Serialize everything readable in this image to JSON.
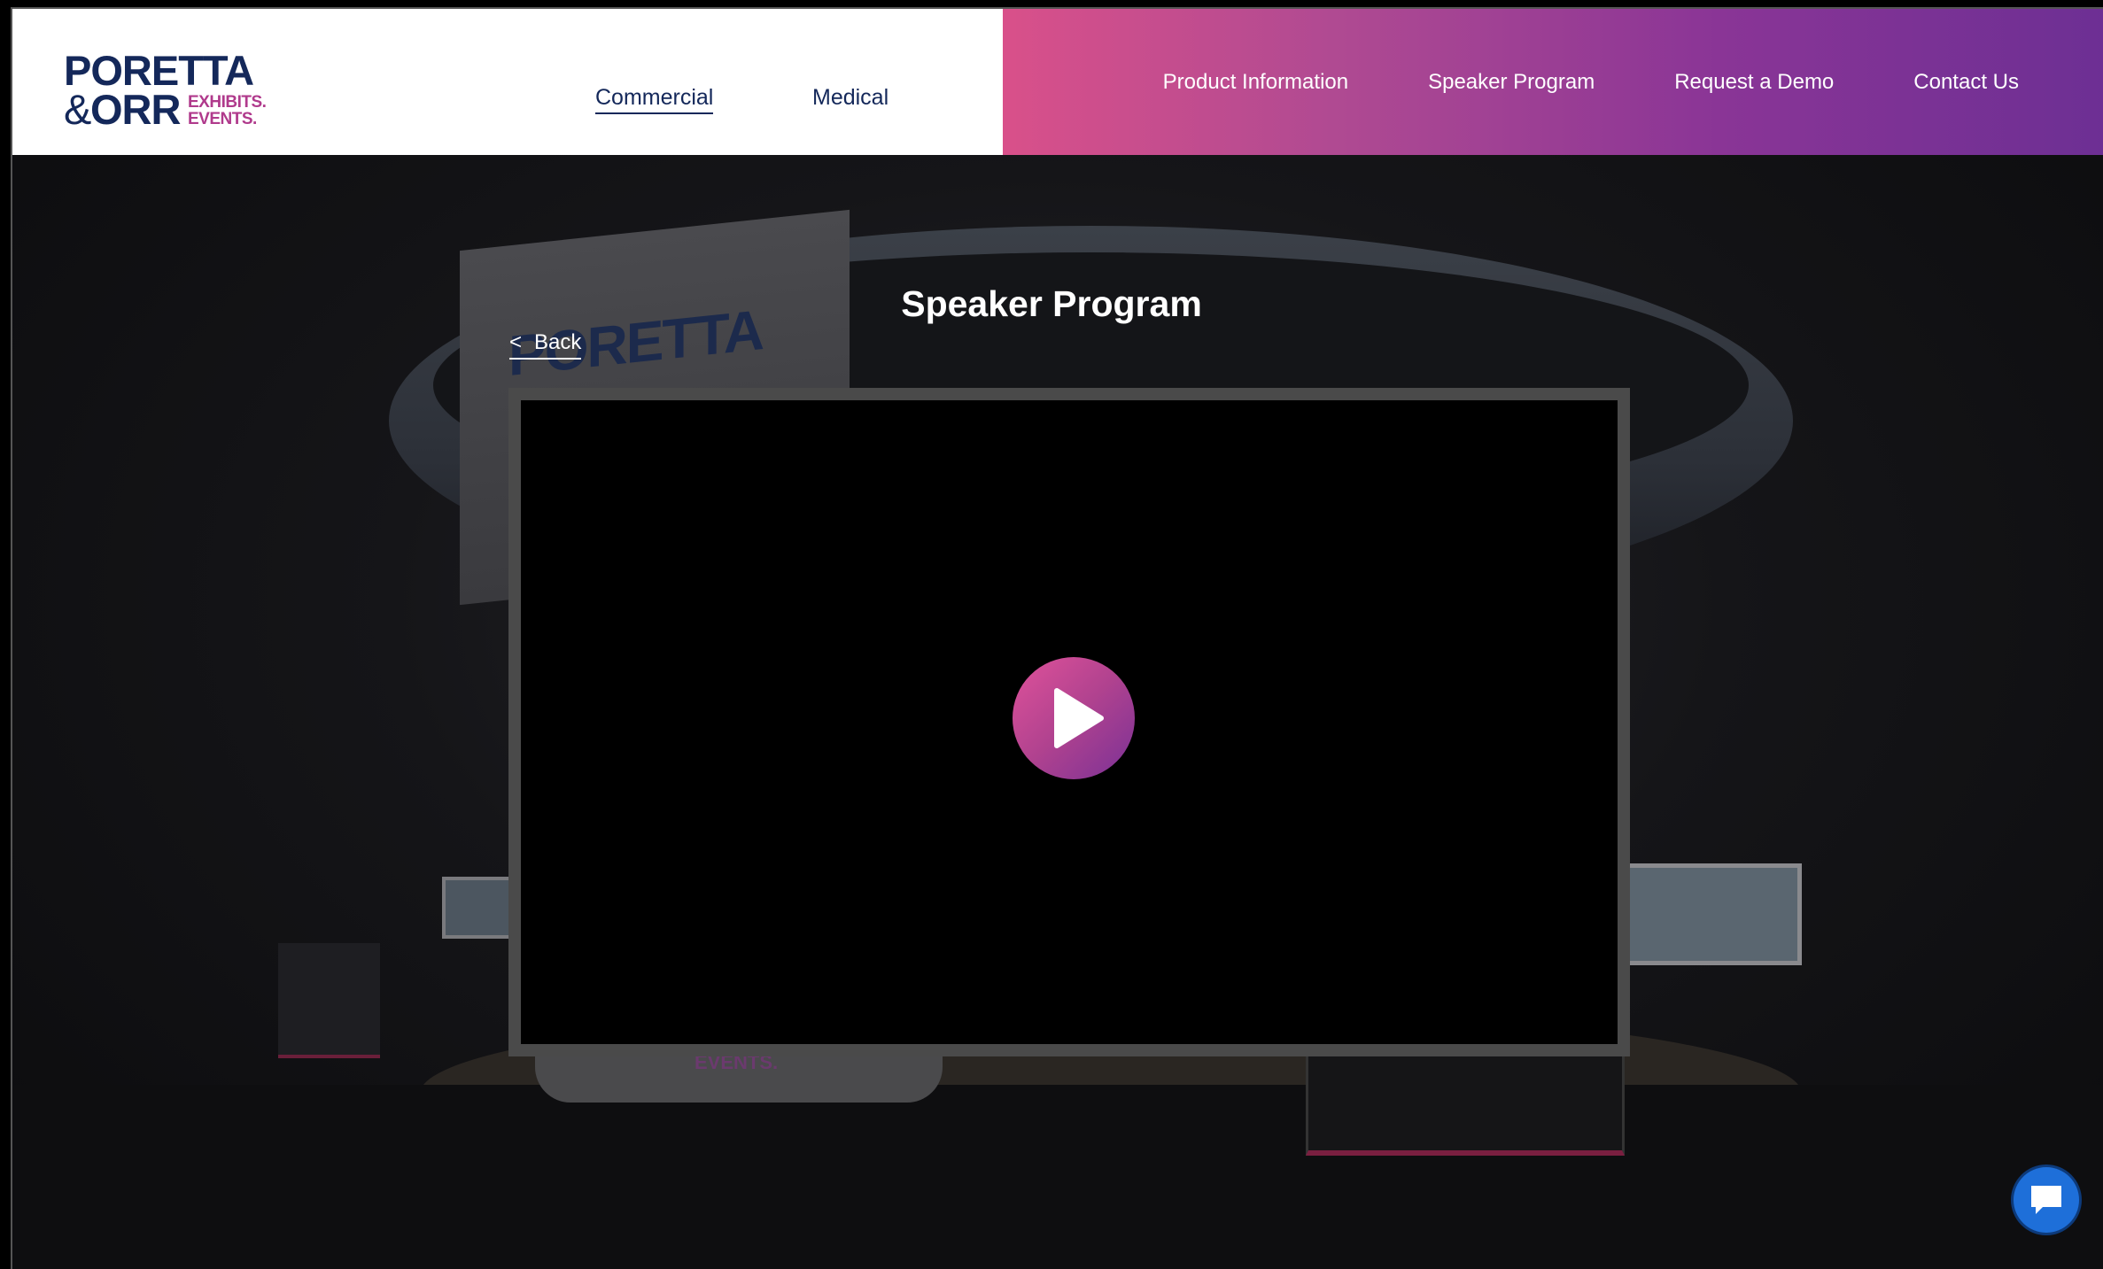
{
  "logo": {
    "line1": "PORETTA",
    "amp": "&",
    "line2": "ORR",
    "exhibits": "EXHIBITS.",
    "events": "EVENTS."
  },
  "nav_left": {
    "commercial": "Commercial",
    "medical": "Medical"
  },
  "nav_right": {
    "product_information": "Product Information",
    "speaker_program": "Speaker Program",
    "request_demo": "Request a Demo",
    "contact_us": "Contact Us"
  },
  "scene": {
    "ring_text": "PORETTA",
    "base_text": "EVENTS."
  },
  "page": {
    "title": "Speaker Program",
    "back_arrow": "<",
    "back_label": "Back"
  },
  "icons": {
    "play": "play-icon",
    "chat": "chat-icon"
  },
  "colors": {
    "brand_navy": "#14285a",
    "gradient_start": "#d9508a",
    "gradient_end": "#6d2f94",
    "chat_blue": "#1e6fd9"
  }
}
